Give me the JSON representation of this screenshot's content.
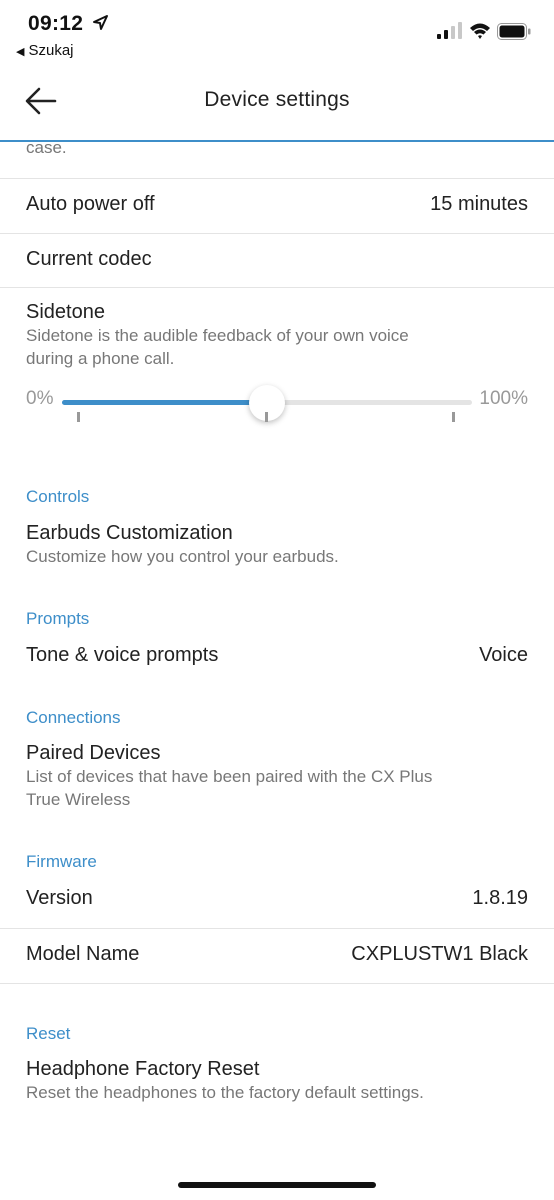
{
  "status_bar": {
    "time": "09:12",
    "back_app_label": "Szukaj",
    "icons": [
      "location-arrow-icon",
      "cellular-signal-icon",
      "wifi-icon",
      "battery-icon"
    ]
  },
  "nav": {
    "title": "Device settings",
    "back_icon": "back-arrow-icon"
  },
  "top_cutoff_text": "case.",
  "auto_power_off": {
    "label": "Auto power off",
    "value": "15 minutes"
  },
  "current_codec": {
    "label": "Current codec"
  },
  "sidetone": {
    "title": "Sidetone",
    "description": "Sidetone is the audible feedback of your own voice during a phone call.",
    "min_label": "0%",
    "max_label": "100%",
    "level_fraction": 0.5
  },
  "controls": {
    "header": "Controls",
    "item_title": "Earbuds Customization",
    "item_desc": "Customize how you control your earbuds."
  },
  "prompts": {
    "header": "Prompts",
    "label": "Tone & voice prompts",
    "value": "Voice"
  },
  "connections": {
    "header": "Connections",
    "item_title": "Paired Devices",
    "item_desc": "List of devices that have been paired with the CX Plus True Wireless"
  },
  "firmware": {
    "header": "Firmware",
    "version_label": "Version",
    "version_value": "1.8.19",
    "model_label": "Model Name",
    "model_value": "CXPLUSTW1 Black"
  },
  "reset": {
    "header": "Reset",
    "item_title": "Headphone Factory Reset",
    "item_desc": "Reset the headphones to the factory default settings."
  },
  "colors": {
    "accent": "#3d8ec9",
    "text_primary": "#222222",
    "text_secondary": "#777777",
    "divider": "#e4e4e4"
  }
}
